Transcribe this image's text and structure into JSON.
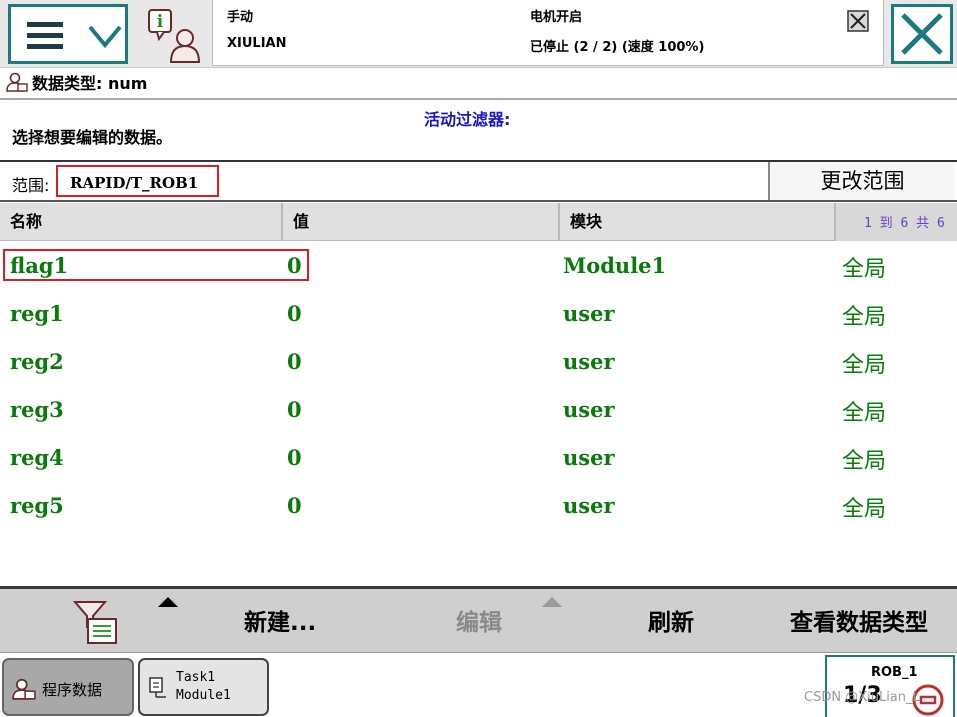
{
  "topbar": {
    "mode": "手动",
    "controller": "XIULIAN",
    "motor_state": "电机开启",
    "run_state": "已停止 (2 / 2) (速度 100%)"
  },
  "header": {
    "data_type_label": "数据类型: num",
    "filter_label": "活动过滤器:",
    "instruction": "选择想要编辑的数据。"
  },
  "scope": {
    "label": "范围:",
    "value": "RAPID/T_ROB1",
    "change_button": "更改范围"
  },
  "table": {
    "columns": [
      "名称",
      "值",
      "模块"
    ],
    "pager": "1 到 6 共 6",
    "rows": [
      {
        "name": "flag1",
        "value": "0",
        "module": "Module1",
        "scope": "全局"
      },
      {
        "name": "reg1",
        "value": "0",
        "module": "user",
        "scope": "全局"
      },
      {
        "name": "reg2",
        "value": "0",
        "module": "user",
        "scope": "全局"
      },
      {
        "name": "reg3",
        "value": "0",
        "module": "user",
        "scope": "全局"
      },
      {
        "name": "reg4",
        "value": "0",
        "module": "user",
        "scope": "全局"
      },
      {
        "name": "reg5",
        "value": "0",
        "module": "user",
        "scope": "全局"
      }
    ]
  },
  "commands": {
    "new": "新建...",
    "edit": "编辑",
    "refresh": "刷新",
    "view_type": "查看数据类型"
  },
  "taskbar": {
    "program_data": "程序数据",
    "task_line1": "Task1",
    "task_line2": "Module1",
    "rob": "ROB_1",
    "rob_fraction": "1/3"
  },
  "watermark": "CSDN @XiuLian_L",
  "colors": {
    "accent": "#1b7a7f",
    "highlight": "#d42020",
    "row_text": "#0a7a0a",
    "filter_text": "#1818c8",
    "pager_text": "#6a3ec8"
  },
  "icons": [
    "menu-icon",
    "chevron-down-icon",
    "info-user-icon",
    "motor-status-icon",
    "close-icon",
    "user-data-icon",
    "filter-icon",
    "task-icon",
    "jog-icon"
  ]
}
